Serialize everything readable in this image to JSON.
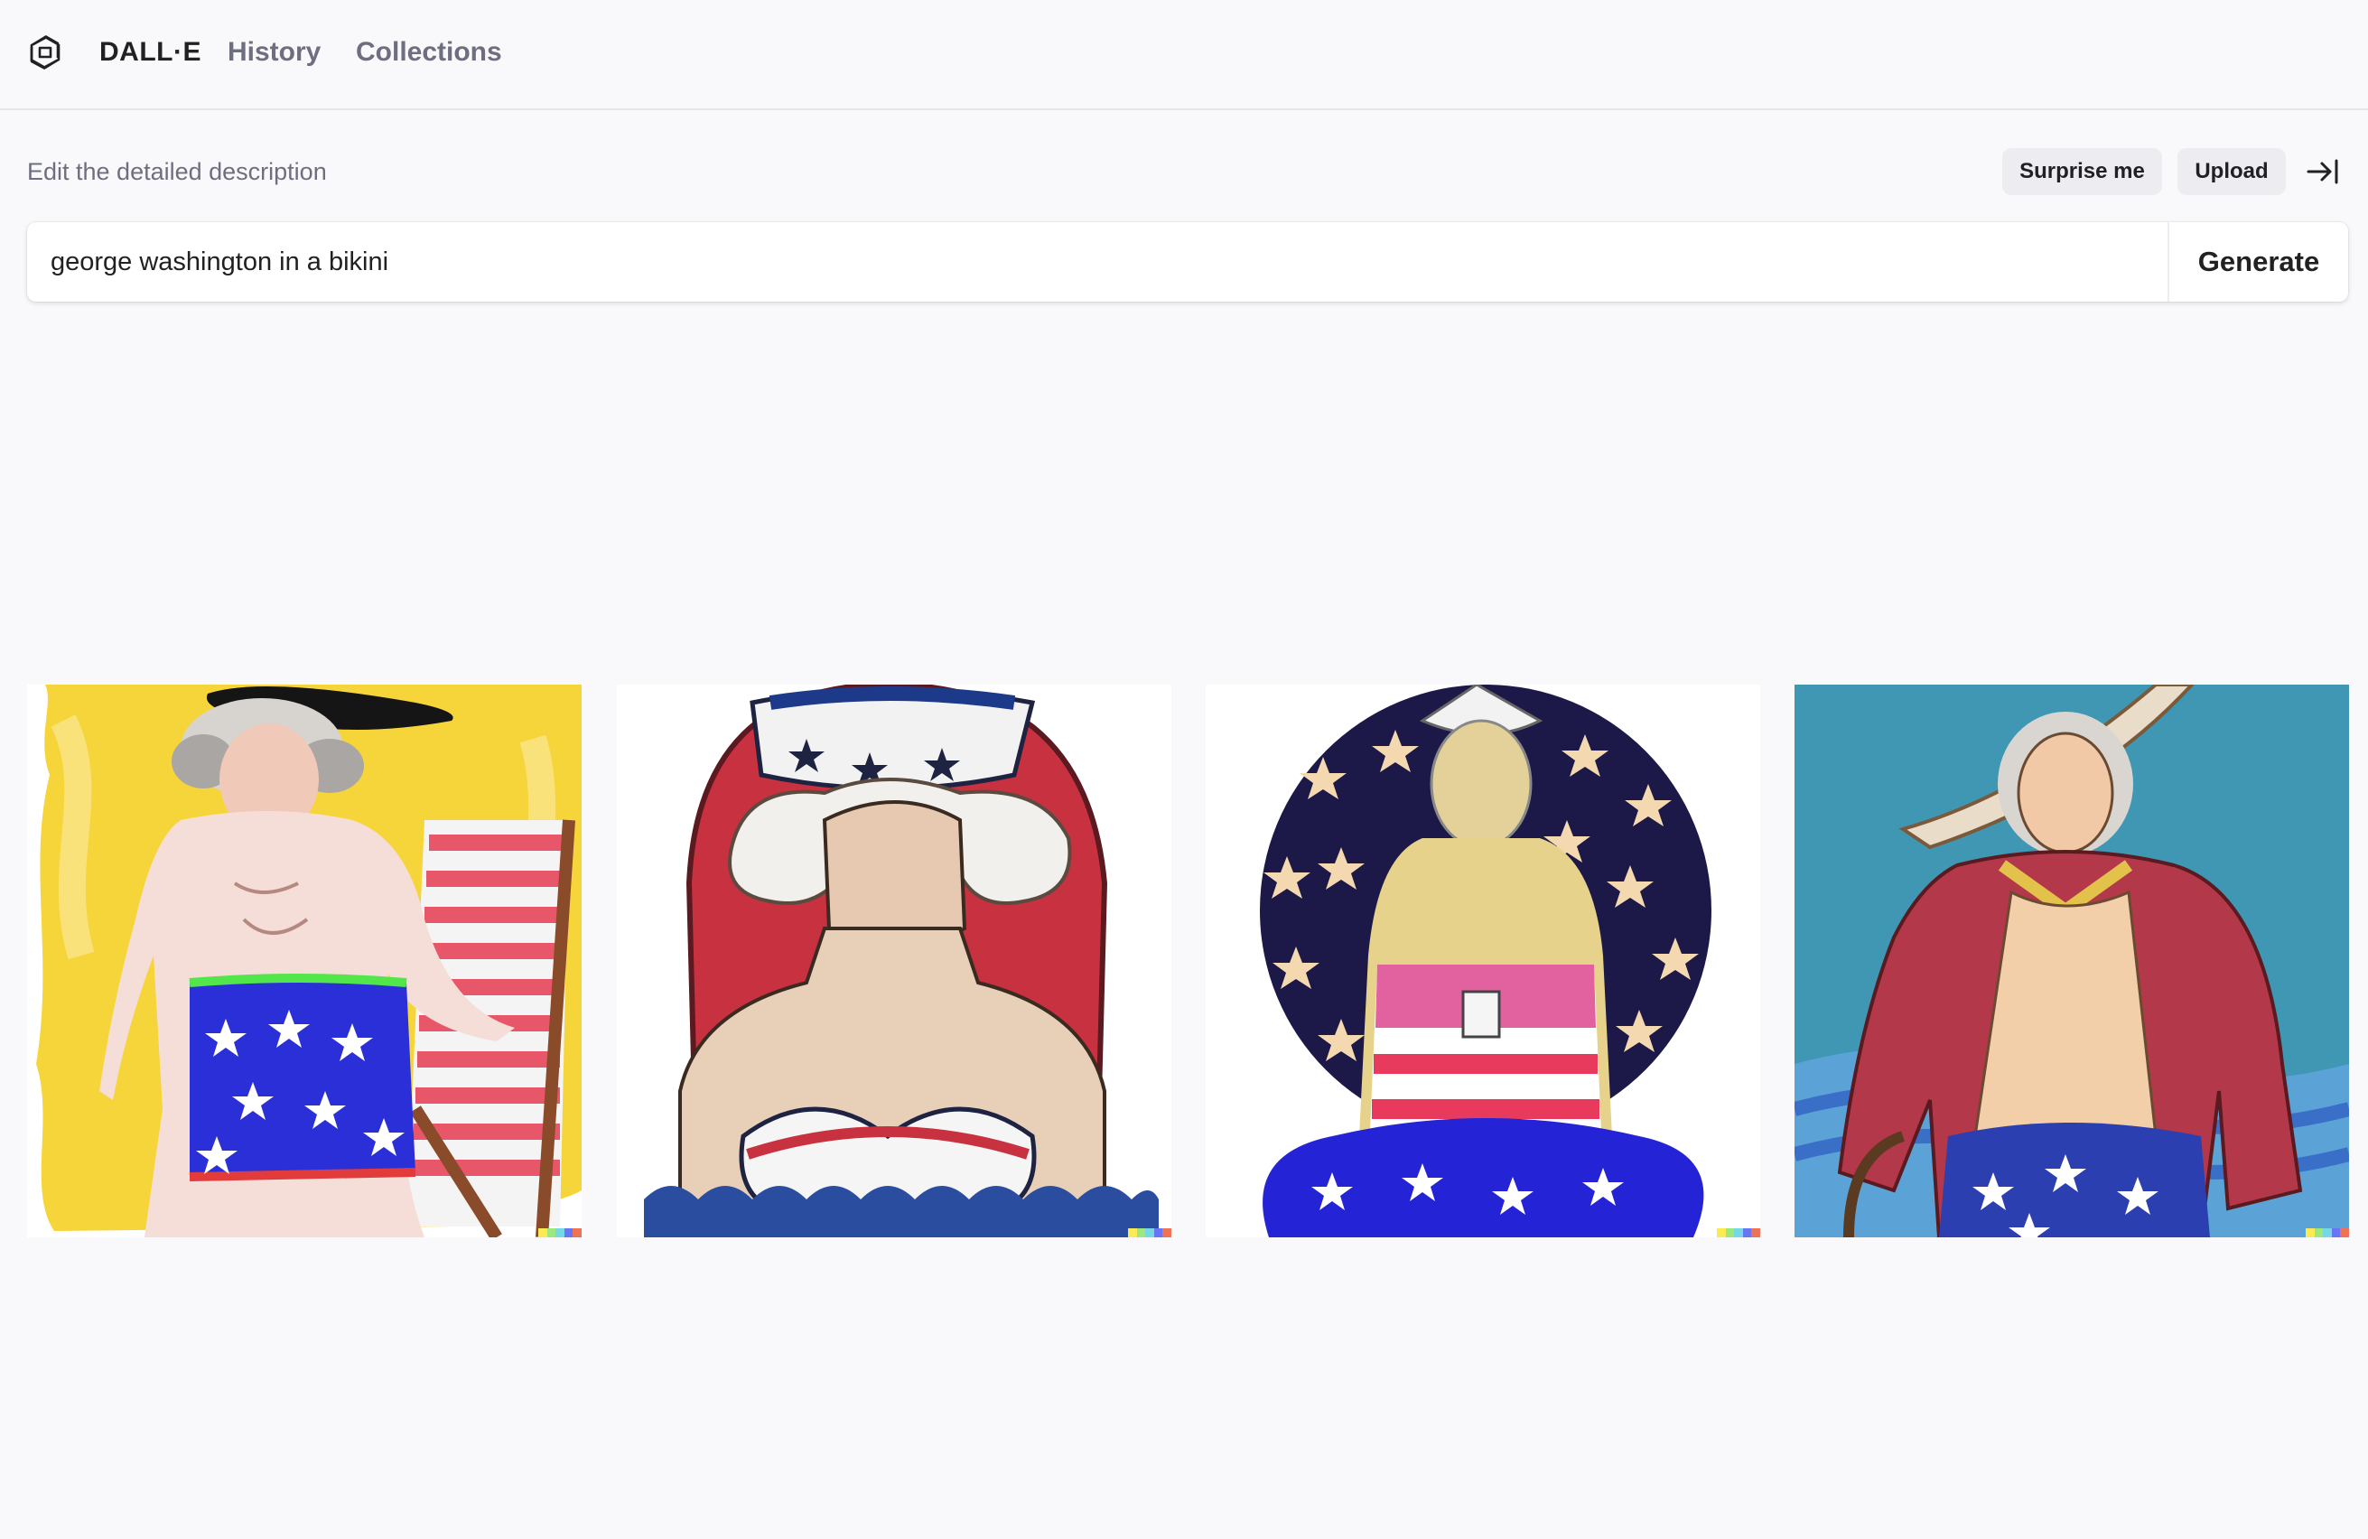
{
  "header": {
    "brand": "DALL·E",
    "nav": {
      "history": "History",
      "collections": "Collections"
    }
  },
  "prompt": {
    "label": "Edit the detailed description",
    "value": "george washington in a bikini",
    "generate_label": "Generate",
    "surprise_label": "Surprise me",
    "upload_label": "Upload"
  },
  "results": [
    {
      "alt": "George Washington in stars and stripes swim trunks by a beach chair"
    },
    {
      "alt": "George Washington in a stars and stripes hat and bikini top"
    },
    {
      "alt": "George Washington sitting in front of a starry circle with flag sarong"
    },
    {
      "alt": "George Washington in red coat with star spangled shorts by the sea"
    }
  ],
  "colors": {
    "background": "#f9f9fb",
    "text": "#202123",
    "muted": "#6e6e80",
    "pill": "#ececf1",
    "signature": [
      "#fbea52",
      "#9de87d",
      "#75d8e4",
      "#6875f4",
      "#ee7356"
    ]
  }
}
